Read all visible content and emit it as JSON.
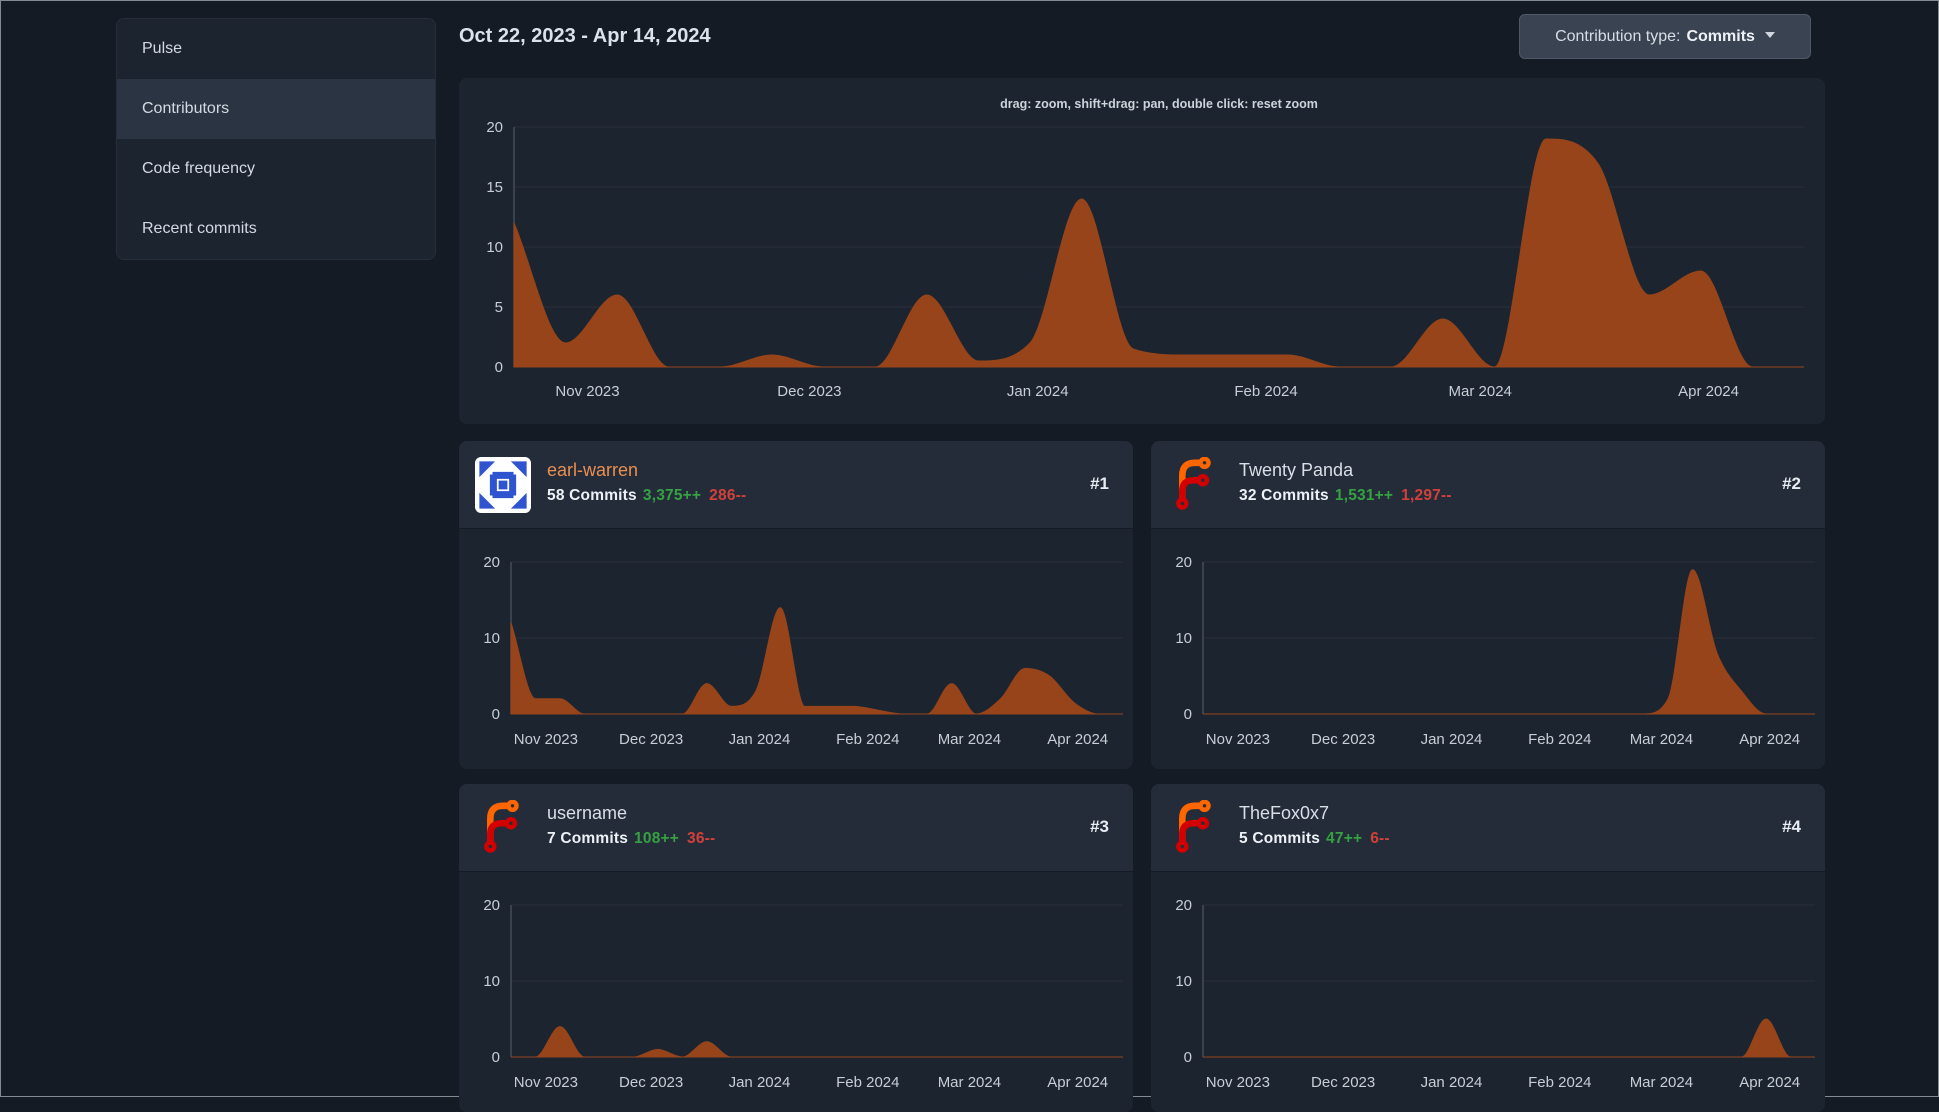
{
  "sidebar": {
    "items": [
      {
        "label": "Pulse",
        "active": false
      },
      {
        "label": "Contributors",
        "active": true
      },
      {
        "label": "Code frequency",
        "active": false
      },
      {
        "label": "Recent commits",
        "active": false
      }
    ]
  },
  "header": {
    "title": "Oct 22, 2023 - Apr 14, 2024",
    "contribution_type_label": "Contribution type:",
    "contribution_type_value": "Commits"
  },
  "main_chart": {
    "hint": "drag: zoom, shift+drag: pan, double click: reset zoom"
  },
  "contributors": [
    {
      "rank": "#1",
      "name": "earl-warren",
      "commits": "58 Commits",
      "additions": "3,375++",
      "deletions": "286--",
      "avatar": "identicon",
      "is_link": true
    },
    {
      "rank": "#2",
      "name": "Twenty Panda",
      "commits": "32 Commits",
      "additions": "1,531++",
      "deletions": "1,297--",
      "avatar": "forgejo-logo",
      "is_link": false
    },
    {
      "rank": "#3",
      "name": "username",
      "commits": "7 Commits",
      "additions": "108++",
      "deletions": "36--",
      "avatar": "forgejo-logo",
      "is_link": false
    },
    {
      "rank": "#4",
      "name": "TheFox0x7",
      "commits": "5 Commits",
      "additions": "47++",
      "deletions": "6--",
      "avatar": "forgejo-logo",
      "is_link": false
    }
  ],
  "chart_data": [
    {
      "id": "total-commits-per-week",
      "type": "area",
      "title": "Commits per week (all contributors)",
      "x_unit": "week",
      "x_start": "Oct 22, 2023",
      "x_end": "Apr 14, 2024",
      "values": [
        12,
        2,
        6,
        0,
        0,
        1,
        0,
        0,
        6,
        0.5,
        2,
        14,
        1.5,
        1,
        1,
        1,
        0,
        0,
        4,
        0,
        19,
        17,
        6,
        8,
        0,
        0
      ],
      "ylim": [
        0,
        20
      ],
      "yticks": [
        0,
        5,
        10,
        15,
        20
      ],
      "months": [
        "Nov 2023",
        "Dec 2023",
        "Jan 2024",
        "Feb 2024",
        "Mar 2024",
        "Apr 2024"
      ],
      "month_positions": [
        0.057,
        0.229,
        0.406,
        0.583,
        0.749,
        0.926
      ],
      "grid": true,
      "legend": "none"
    },
    {
      "id": "earl-warren-commits",
      "type": "area",
      "title": "earl-warren commits per week",
      "x_unit": "week",
      "x_start": "Oct 22, 2023",
      "x_end": "Apr 14, 2024",
      "values": [
        12,
        2,
        2,
        0,
        0,
        0,
        0,
        0,
        4,
        1,
        3,
        14,
        1,
        1,
        1,
        0.5,
        0,
        0,
        4,
        0,
        2,
        6,
        5,
        1.5,
        0,
        0
      ],
      "ylim": [
        0,
        20
      ],
      "yticks": [
        0,
        10,
        20
      ],
      "months": [
        "Nov 2023",
        "Dec 2023",
        "Jan 2024",
        "Feb 2024",
        "Mar 2024",
        "Apr 2024"
      ],
      "month_positions": [
        0.057,
        0.229,
        0.406,
        0.583,
        0.749,
        0.926
      ],
      "grid": true,
      "legend": "none"
    },
    {
      "id": "twenty-panda-commits",
      "type": "area",
      "title": "Twenty Panda commits per week",
      "x_unit": "week",
      "x_start": "Oct 22, 2023",
      "x_end": "Apr 14, 2024",
      "values": [
        0,
        0,
        0,
        0,
        0,
        0,
        0,
        0,
        0,
        0,
        0,
        0,
        0,
        0,
        0,
        0,
        0,
        0,
        0,
        2,
        19,
        8,
        3,
        0,
        0,
        0
      ],
      "ylim": [
        0,
        20
      ],
      "yticks": [
        0,
        10,
        20
      ],
      "months": [
        "Nov 2023",
        "Dec 2023",
        "Jan 2024",
        "Feb 2024",
        "Mar 2024",
        "Apr 2024"
      ],
      "month_positions": [
        0.057,
        0.229,
        0.406,
        0.583,
        0.749,
        0.926
      ],
      "grid": true,
      "legend": "none"
    },
    {
      "id": "username-commits",
      "type": "area",
      "title": "username commits per week",
      "x_unit": "week",
      "x_start": "Oct 22, 2023",
      "x_end": "Apr 14, 2024",
      "values": [
        0,
        0,
        4,
        0,
        0,
        0,
        1,
        0,
        2,
        0,
        0,
        0,
        0,
        0,
        0,
        0,
        0,
        0,
        0,
        0,
        0,
        0,
        0,
        0,
        0,
        0
      ],
      "ylim": [
        0,
        20
      ],
      "yticks": [
        0,
        10,
        20
      ],
      "months": [
        "Nov 2023",
        "Dec 2023",
        "Jan 2024",
        "Feb 2024",
        "Mar 2024",
        "Apr 2024"
      ],
      "month_positions": [
        0.057,
        0.229,
        0.406,
        0.583,
        0.749,
        0.926
      ],
      "grid": true,
      "legend": "none"
    },
    {
      "id": "thefox0x7-commits",
      "type": "area",
      "title": "TheFox0x7 commits per week",
      "x_unit": "week",
      "x_start": "Oct 22, 2023",
      "x_end": "Apr 14, 2024",
      "values": [
        0,
        0,
        0,
        0,
        0,
        0,
        0,
        0,
        0,
        0,
        0,
        0,
        0,
        0,
        0,
        0,
        0,
        0,
        0,
        0,
        0,
        0,
        0,
        5,
        0,
        0
      ],
      "ylim": [
        0,
        20
      ],
      "yticks": [
        0,
        10,
        20
      ],
      "months": [
        "Nov 2023",
        "Dec 2023",
        "Jan 2024",
        "Feb 2024",
        "Mar 2024",
        "Apr 2024"
      ],
      "month_positions": [
        0.057,
        0.229,
        0.406,
        0.583,
        0.749,
        0.926
      ],
      "grid": true,
      "legend": "none"
    }
  ],
  "colors": {
    "area_fill": "#97441a",
    "additions_green": "#36a143",
    "deletions_red": "#d2403a",
    "link_orange": "#e98f52",
    "logo_orange": "#ff6600",
    "logo_red": "#d40000",
    "identicon_blue": "#2f54cf",
    "card_bg": "#1c242f",
    "card_header_bg": "#242c39",
    "page_bg": "#151b25"
  }
}
